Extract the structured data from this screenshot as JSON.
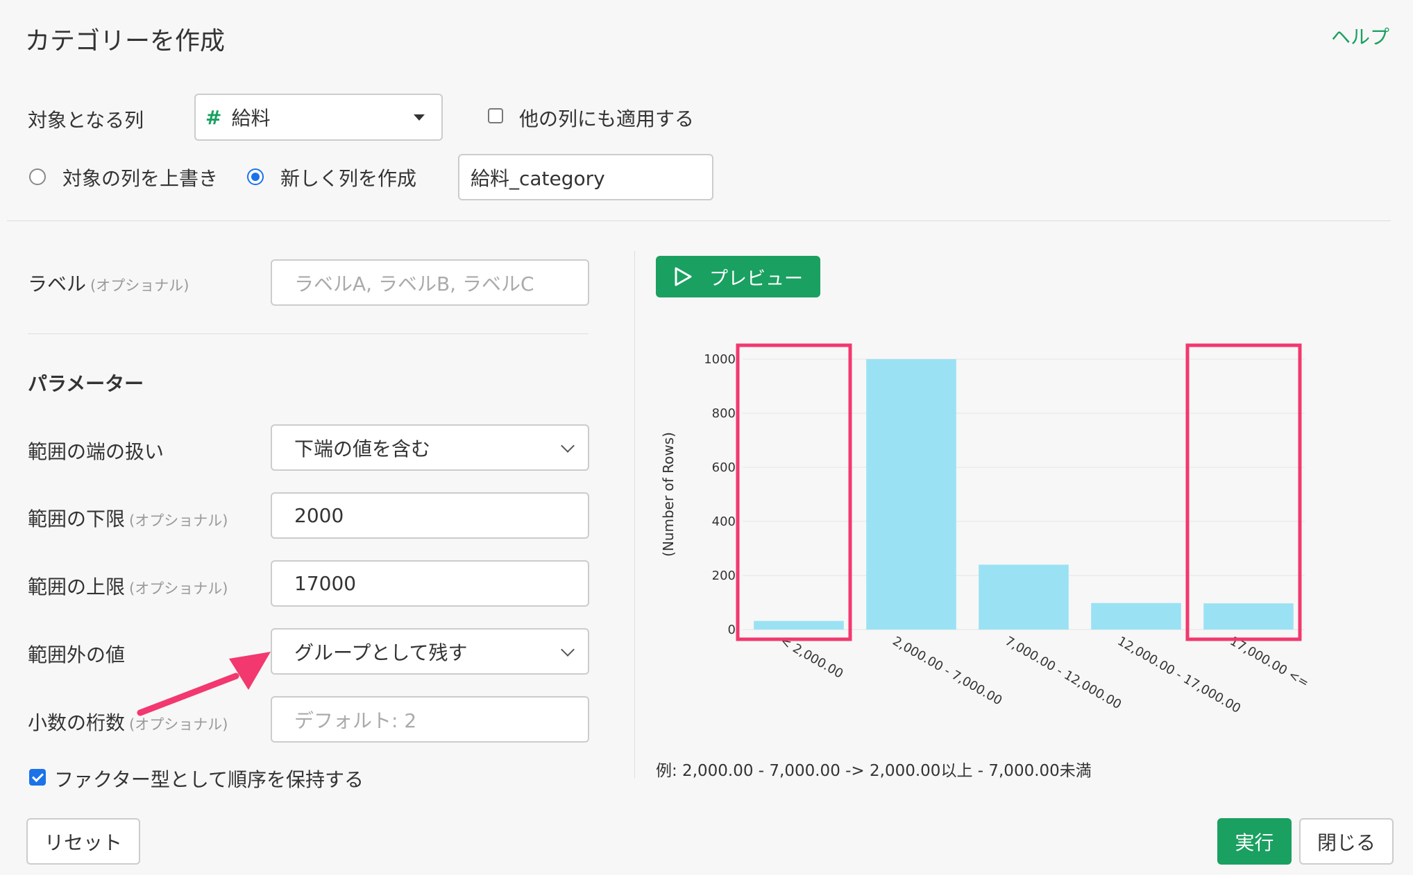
{
  "dialog": {
    "title": "カテゴリーを作成",
    "help": "ヘルプ"
  },
  "target": {
    "label": "対象となる列",
    "column_icon": "#",
    "column": "給料",
    "apply_other_label": "他の列にも適用する",
    "apply_other_checked": false
  },
  "output": {
    "overwrite_label": "対象の列を上書き",
    "new_label": "新しく列を作成",
    "selected": "new",
    "new_column_name": "給料_category"
  },
  "label_field": {
    "label": "ラベル",
    "optional": "(オプショナル)",
    "placeholder": "ラベルA, ラベルB, ラベルC"
  },
  "params": {
    "heading": "パラメーター",
    "edge_label": "範囲の端の扱い",
    "edge_value": "下端の値を含む",
    "lower_label": "範囲の下限",
    "lower_optional": "(オプショナル)",
    "lower_value": "2000",
    "upper_label": "範囲の上限",
    "upper_optional": "(オプショナル)",
    "upper_value": "17000",
    "outside_label": "範囲外の値",
    "outside_value": "グループとして残す",
    "decimal_label": "小数の桁数",
    "decimal_optional": "(オプショナル)",
    "decimal_placeholder": "デフォルト: 2",
    "factor_label": "ファクター型として順序を保持する",
    "factor_checked": true
  },
  "preview_button": "プレビュー",
  "chart_data": {
    "type": "bar",
    "categories": [
      "< 2,000.00",
      "2,000.00 - 7,000.00",
      "7,000.00 - 12,000.00",
      "12,000.00 - 17,000.00",
      "17,000.00 <="
    ],
    "values": [
      32,
      1000,
      240,
      98,
      97
    ],
    "ylabel": "(Number of Rows)",
    "yticks": [
      "0",
      "200",
      "400",
      "600",
      "800",
      "1000"
    ],
    "ylim": [
      0,
      1000
    ],
    "bar_color": "#9ae2f3",
    "highlighted_categories": [
      "< 2,000.00",
      "17,000.00 <="
    ],
    "highlight_color": "#f2386f"
  },
  "example_note": "例: 2,000.00 - 7,000.00 -> 2,000.00以上 - 7,000.00未満",
  "footer": {
    "reset": "リセット",
    "run": "実行",
    "close": "閉じる"
  },
  "colors": {
    "accent": "#1aa061",
    "annotation": "#f2386f"
  }
}
